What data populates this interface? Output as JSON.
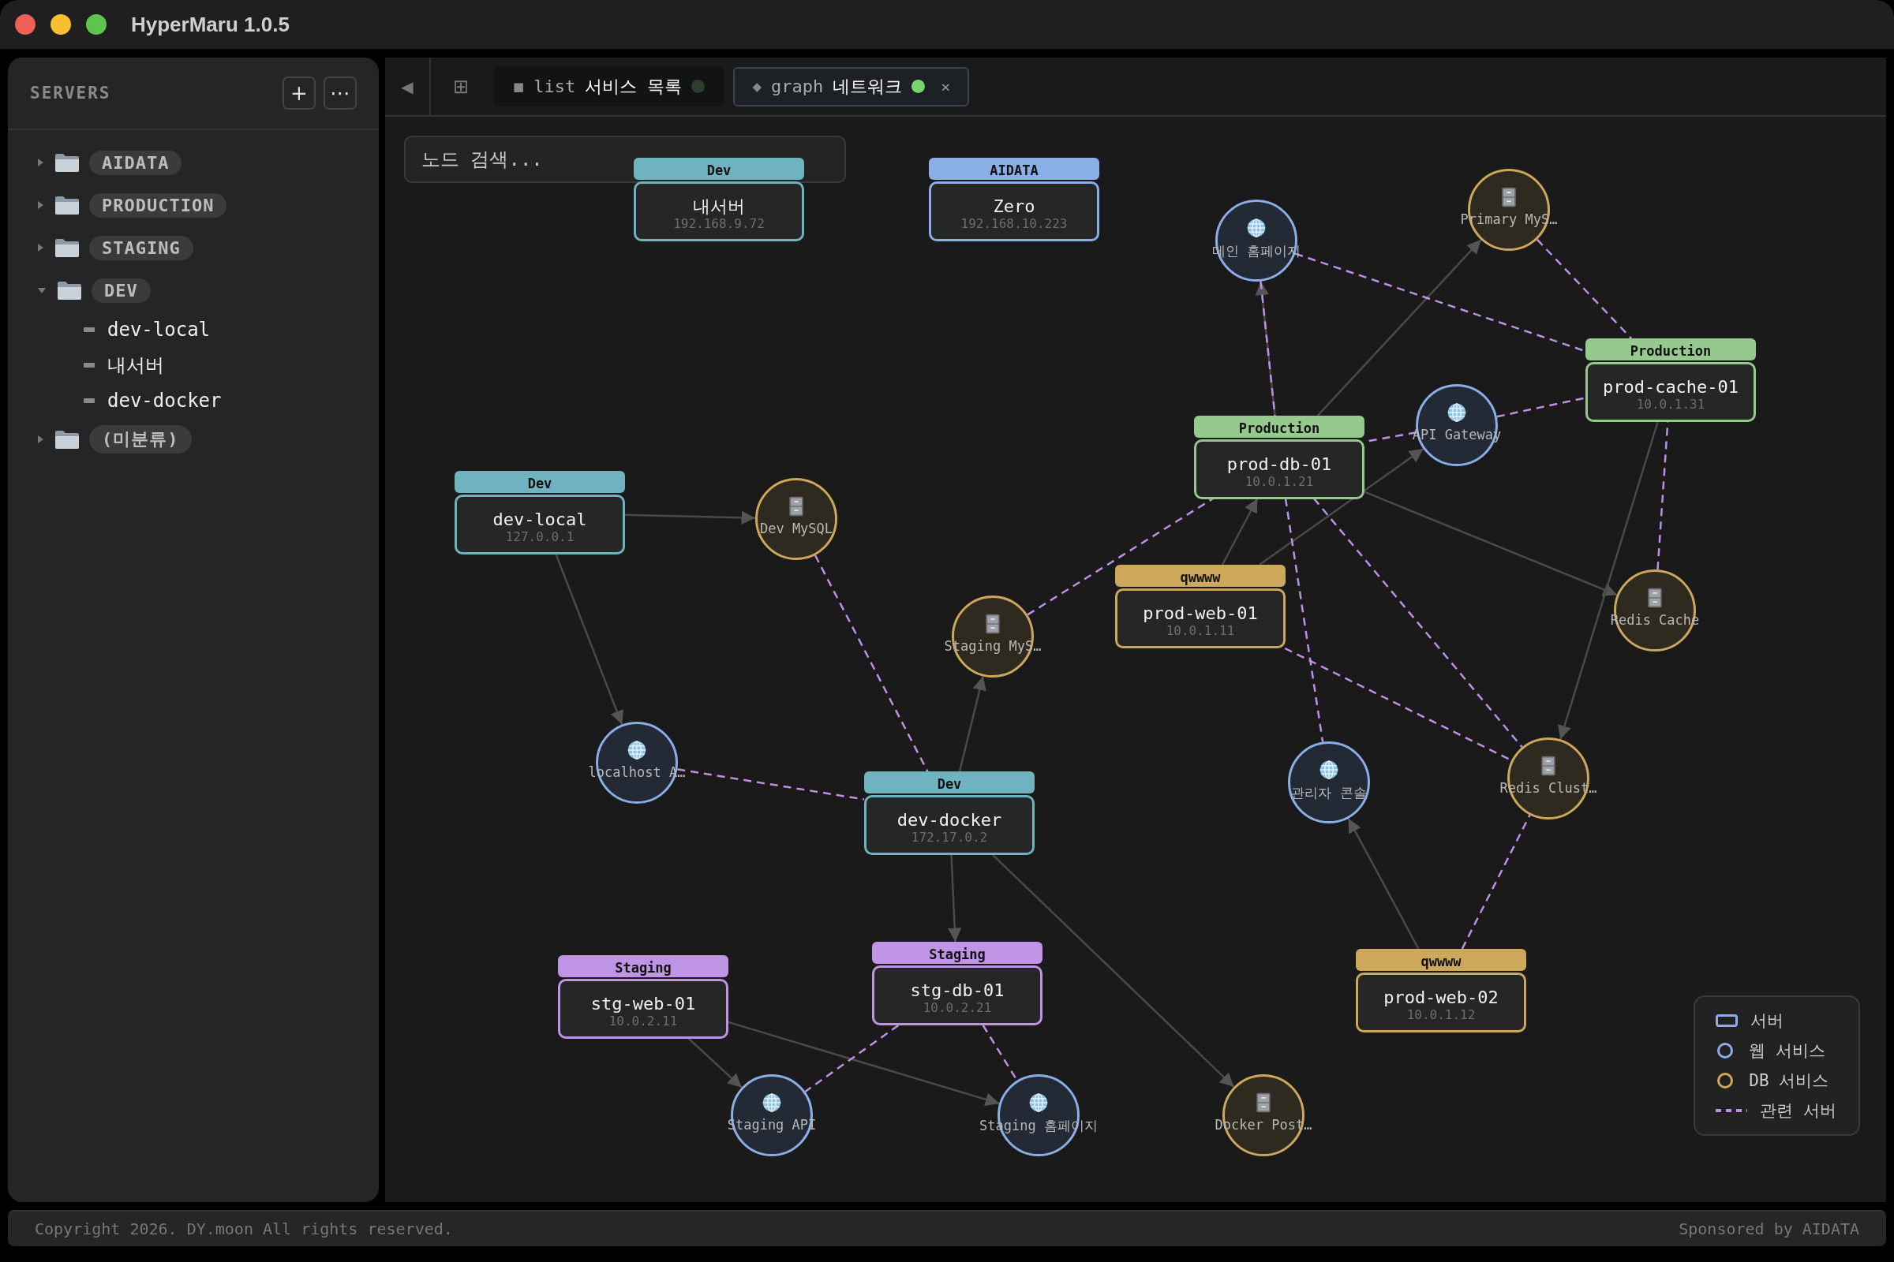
{
  "window": {
    "title": "HyperMaru 1.0.5"
  },
  "sidebar": {
    "heading": "SERVERS",
    "add_button": "+",
    "more_button": "⋯",
    "folders": [
      {
        "label": "AIDATA",
        "expanded": false
      },
      {
        "label": "PRODUCTION",
        "expanded": false
      },
      {
        "label": "STAGING",
        "expanded": false
      },
      {
        "label": "DEV",
        "expanded": true,
        "children": [
          {
            "label": "dev-local"
          },
          {
            "label": "내서버"
          },
          {
            "label": "dev-docker"
          }
        ]
      },
      {
        "label": "(미분류)",
        "expanded": false
      }
    ]
  },
  "toolbar": {
    "back_button": "◀",
    "grid_button": "⊞"
  },
  "tabs": [
    {
      "icon": "■",
      "prefix": "list",
      "title": "서비스 목록",
      "selected": false,
      "status_on": false
    },
    {
      "icon": "◆",
      "prefix": "graph",
      "title": "네트워크",
      "selected": true,
      "status_on": true,
      "close": "×"
    }
  ],
  "search": {
    "placeholder": "노드 검색..."
  },
  "graph": {
    "nodes": [
      {
        "kind": "server",
        "group": "Dev",
        "color": "#6fb3c0",
        "name": "내서버",
        "ip": "192.168.9.72"
      },
      {
        "kind": "server",
        "group": "AIDATA",
        "color": "#8aaee6",
        "name": "Zero",
        "ip": "192.168.10.223"
      },
      {
        "kind": "server",
        "group": "Dev",
        "color": "#6fb3c0",
        "name": "dev-local",
        "ip": "127.0.0.1"
      },
      {
        "kind": "server",
        "group": "Production",
        "color": "#96c98e",
        "name": "prod-db-01",
        "ip": "10.0.1.21"
      },
      {
        "kind": "server",
        "group": "Production",
        "color": "#96c98e",
        "name": "prod-cache-01",
        "ip": "10.0.1.31"
      },
      {
        "kind": "server",
        "group": "qwwww",
        "color": "#cda85a",
        "name": "prod-web-01",
        "ip": "10.0.1.11"
      },
      {
        "kind": "server",
        "group": "Dev",
        "color": "#6fb3c0",
        "name": "dev-docker",
        "ip": "172.17.0.2"
      },
      {
        "kind": "server",
        "group": "Staging",
        "color": "#bf94e4",
        "name": "stg-web-01",
        "ip": "10.0.2.11"
      },
      {
        "kind": "server",
        "group": "Staging",
        "color": "#bf94e4",
        "name": "stg-db-01",
        "ip": "10.0.2.21"
      },
      {
        "kind": "server",
        "group": "qwwww",
        "color": "#cda85a",
        "name": "prod-web-02",
        "ip": "10.0.1.12"
      },
      {
        "kind": "web",
        "label": "메인 홈페이지"
      },
      {
        "kind": "db",
        "label": "Primary MyS…"
      },
      {
        "kind": "web",
        "label": "API Gateway"
      },
      {
        "kind": "db",
        "label": "Redis Cache"
      },
      {
        "kind": "db",
        "label": "Dev MySQL"
      },
      {
        "kind": "db",
        "label": "Staging MyS…"
      },
      {
        "kind": "web",
        "label": "localhost A…"
      },
      {
        "kind": "web",
        "label": "관리자 콘솔"
      },
      {
        "kind": "db",
        "label": "Redis Clust…"
      },
      {
        "kind": "web",
        "label": "Staging API"
      },
      {
        "kind": "web",
        "label": "Staging 홈페이지"
      },
      {
        "kind": "db",
        "label": "Docker Post…"
      }
    ],
    "legend": [
      {
        "kind": "server",
        "label": "서버"
      },
      {
        "kind": "web",
        "label": "웹 서비스"
      },
      {
        "kind": "db",
        "label": "DB 서비스"
      },
      {
        "kind": "related",
        "label": "관련 서버"
      }
    ]
  },
  "footer": {
    "copyright": "Copyright 2026. DY.moon All rights reserved.",
    "sponsor": "Sponsored by AIDATA"
  }
}
